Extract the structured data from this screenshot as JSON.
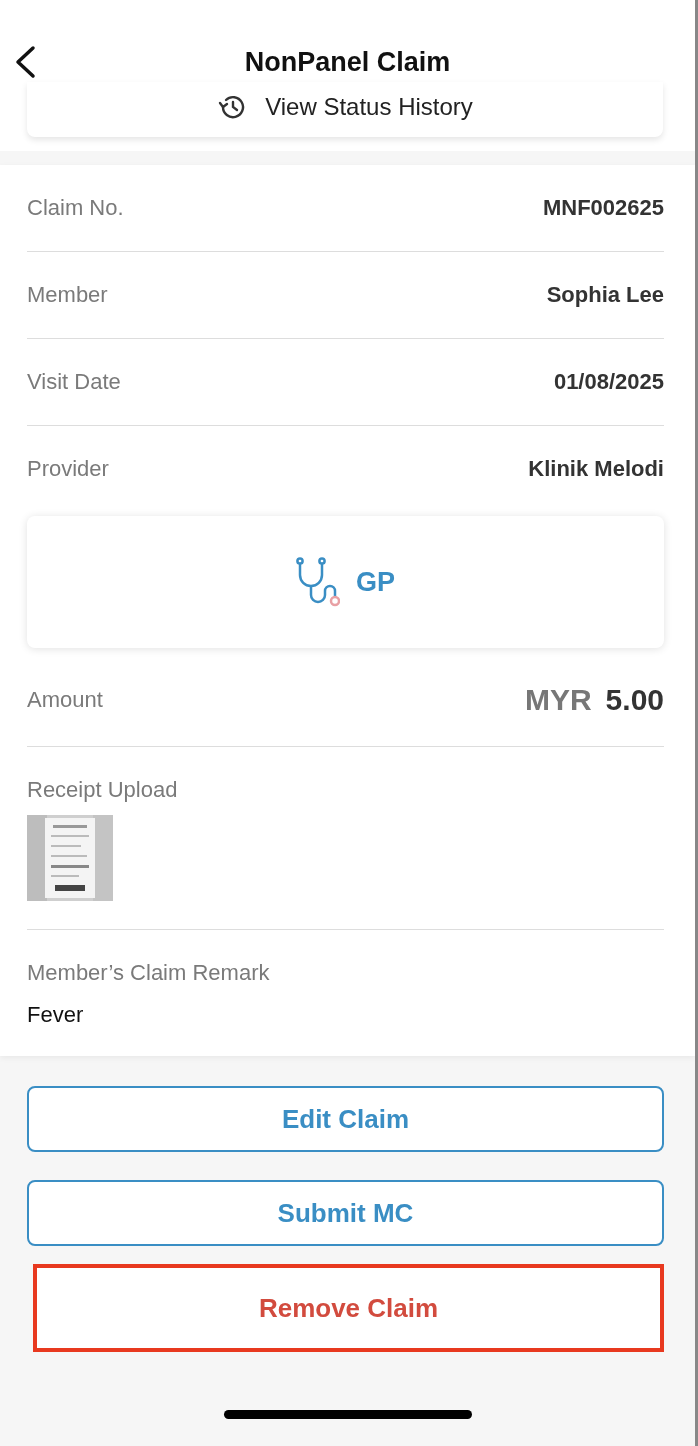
{
  "header": {
    "title": "NonPanel Claim"
  },
  "status_history": {
    "label": "View Status History"
  },
  "details": [
    {
      "kind": "row",
      "label": "Claim No.",
      "value": "MNF002625"
    },
    {
      "kind": "row",
      "label": "Member",
      "value": "Sophia Lee"
    },
    {
      "kind": "row",
      "label": "Visit Date",
      "value": "01/08/2025"
    },
    {
      "kind": "row",
      "label": "Provider",
      "value": "Klinik Melodi"
    },
    {
      "kind": "provider_card",
      "value": "GP"
    },
    {
      "kind": "amount",
      "label": "Amount",
      "currency": "MYR",
      "value": "5.00"
    },
    {
      "kind": "receipt",
      "label": "Receipt Upload"
    },
    {
      "kind": "remark",
      "label": "Member’s Claim Remark",
      "value": "Fever"
    }
  ],
  "buttons": [
    {
      "label": "Edit Claim",
      "kind": "primary"
    },
    {
      "label": "Submit MC",
      "kind": "primary"
    },
    {
      "label": "Remove Claim",
      "kind": "danger"
    }
  ]
}
